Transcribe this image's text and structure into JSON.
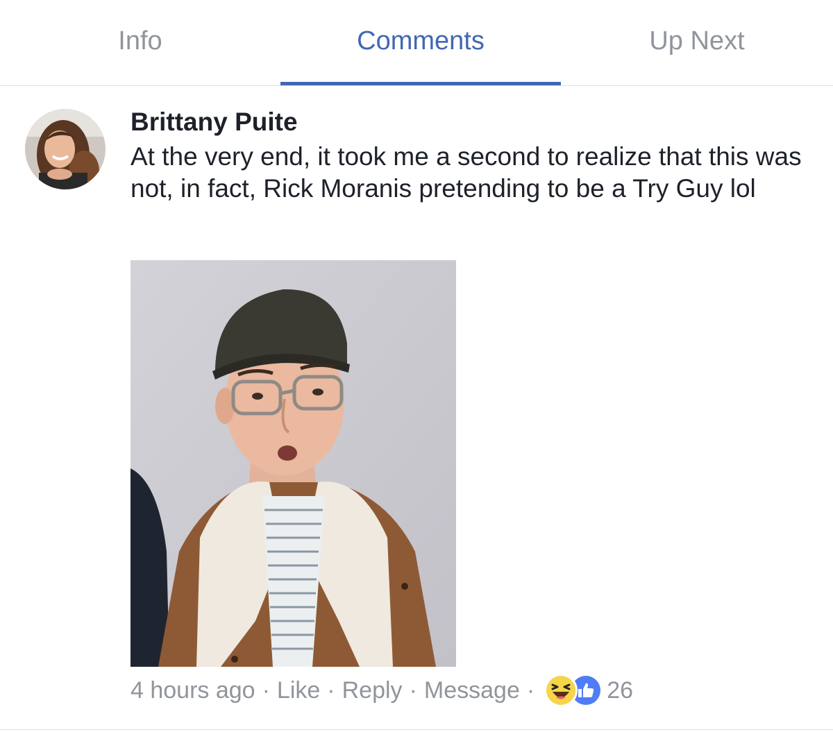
{
  "tabs": {
    "info": "Info",
    "comments": "Comments",
    "up_next": "Up Next",
    "active": "comments",
    "accent_color": "#4267b2",
    "inactive_color": "#90949c"
  },
  "comment": {
    "author": "Brittany Puite",
    "text": "At the very end, it took me a second to realize that this was not, in fact, Rick Moranis pretending to be a Try Guy lol",
    "meta": {
      "timestamp": "4 hours ago",
      "separator": "·",
      "like": "Like",
      "reply": "Reply",
      "message": "Message",
      "reactions": [
        "haha-icon",
        "like-icon"
      ],
      "reaction_count": "26"
    }
  }
}
